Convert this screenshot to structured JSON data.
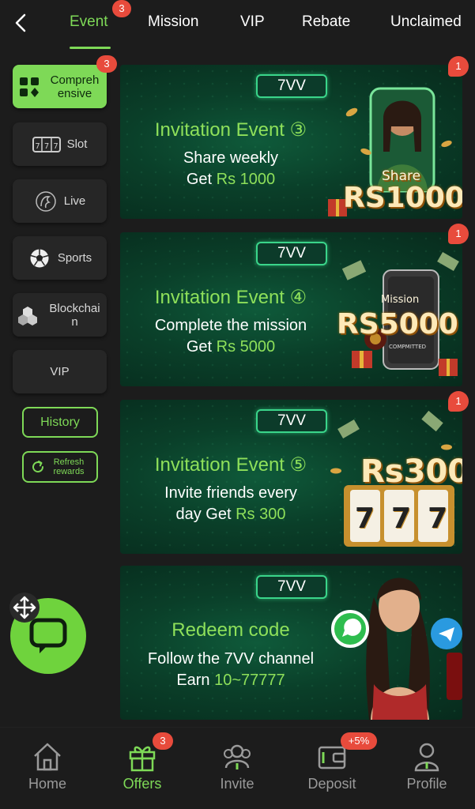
{
  "topnav": {
    "tabs": [
      {
        "label": "Event",
        "badge": "3",
        "active": true
      },
      {
        "label": "Mission"
      },
      {
        "label": "VIP"
      },
      {
        "label": "Rebate"
      },
      {
        "label": "Unclaimed"
      }
    ]
  },
  "sidebar": {
    "items": [
      {
        "label": "Compreh ensive",
        "icon": "grid-icon",
        "badge": "3",
        "active": true
      },
      {
        "label": "Slot",
        "icon": "slot-machine-icon"
      },
      {
        "label": "Live",
        "icon": "live-dealer-icon"
      },
      {
        "label": "Sports",
        "icon": "soccer-ball-icon"
      },
      {
        "label": "Blockchai n",
        "icon": "blockchain-icon"
      },
      {
        "label": "VIP"
      }
    ],
    "history_label": "History",
    "refresh_label": "Refresh rewards"
  },
  "banners": [
    {
      "brand": "7VV",
      "title": "Invitation Event ③",
      "line1_text": "Share weekly",
      "line2_prefix": "Get ",
      "line2_highlight": "Rs 1000",
      "art_top": "Share",
      "art_amount": "RS1000",
      "badge": "1"
    },
    {
      "brand": "7VV",
      "title": "Invitation Event ④",
      "line1_text": "Complete the mission",
      "line2_prefix": "Get ",
      "line2_highlight": "Rs 5000",
      "art_top": "Mission",
      "art_amount": "RS5000",
      "art_sub": "COMPMITTED",
      "badge": "1"
    },
    {
      "brand": "7VV",
      "title": "Invitation Event ⑤",
      "line1_text": "Invite friends every",
      "line2_prefix": "day Get ",
      "line2_highlight": "Rs 300",
      "art_amount": "Rs300",
      "art_reels": "777",
      "badge": "1"
    },
    {
      "brand": "7VV",
      "title": "Redeem code",
      "line1_text": "Follow the 7VV channel",
      "line2_prefix": "Earn ",
      "line2_highlight": "10~77777"
    }
  ],
  "bottomnav": {
    "items": [
      {
        "label": "Home",
        "icon": "home-icon"
      },
      {
        "label": "Offers",
        "icon": "gift-icon",
        "badge": "3",
        "active": true
      },
      {
        "label": "Invite",
        "icon": "invite-icon"
      },
      {
        "label": "Deposit",
        "icon": "wallet-icon",
        "badge": "+5%"
      },
      {
        "label": "Profile",
        "icon": "profile-icon"
      }
    ]
  },
  "colors": {
    "accent": "#7ed957",
    "badge": "#e84b3c",
    "background": "#1c1c1c",
    "banner": "#0a3f29"
  }
}
